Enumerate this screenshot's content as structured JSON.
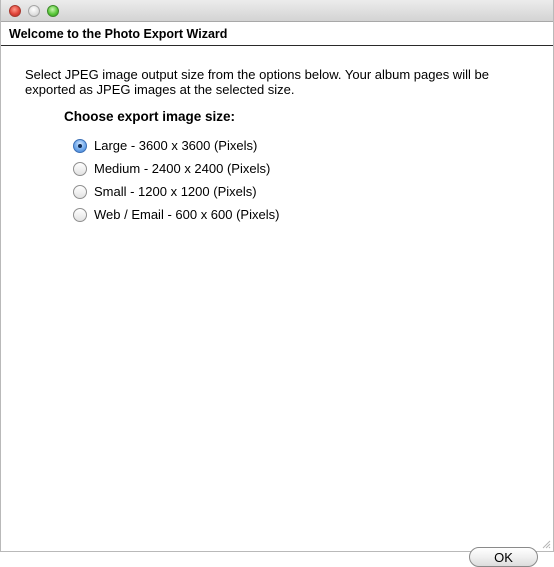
{
  "window": {
    "controls": {
      "close_icon": "close-icon",
      "minimize_icon": "minimize-icon",
      "zoom_icon": "zoom-icon"
    }
  },
  "header": {
    "title": "Welcome to the Photo Export Wizard"
  },
  "main": {
    "description": "Select JPEG image output size from the options below. Your album pages will be exported as JPEG images at the selected size.",
    "group_label": "Choose export image size:",
    "options": [
      {
        "label": "Large - 3600 x 3600 (Pixels)",
        "selected": true
      },
      {
        "label": "Medium - 2400 x 2400 (Pixels)",
        "selected": false
      },
      {
        "label": "Small - 1200 x 1200 (Pixels)",
        "selected": false
      },
      {
        "label": "Web / Email - 600 x 600 (Pixels)",
        "selected": false
      }
    ]
  },
  "footer": {
    "ok_label": "OK"
  },
  "colors": {
    "selected_radio": "#3a7fd4",
    "close_button": "#e0443a",
    "zoom_button": "#5ac83a"
  }
}
